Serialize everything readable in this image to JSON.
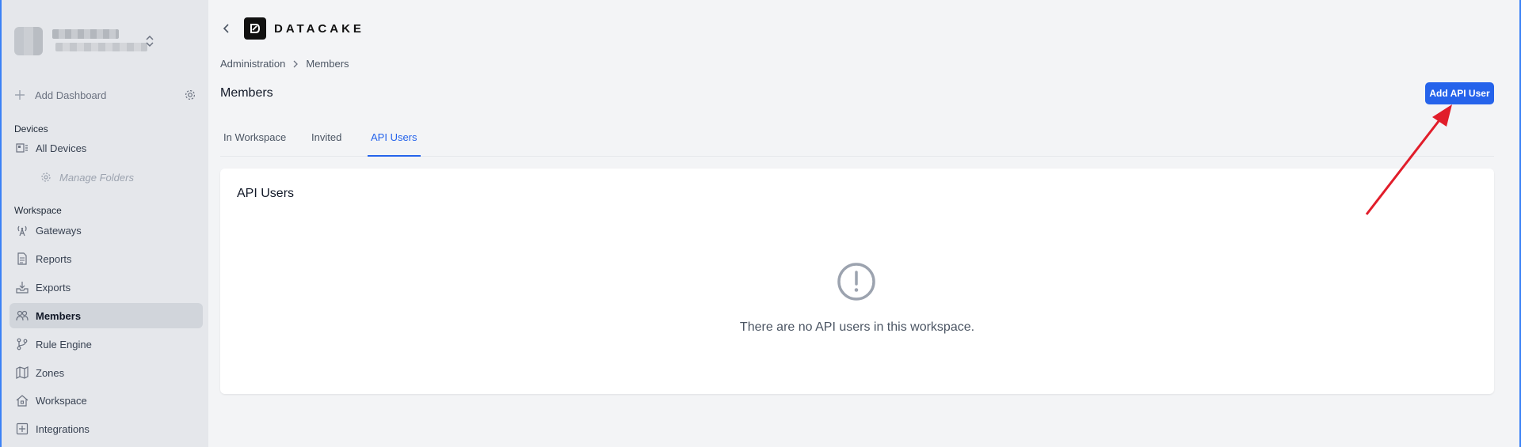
{
  "sidebar": {
    "add_dashboard": "Add Dashboard",
    "devices_label": "Devices",
    "all_devices": "All Devices",
    "manage_folders": "Manage Folders",
    "workspace_label": "Workspace",
    "items": [
      {
        "label": "Gateways",
        "icon": "antenna-icon"
      },
      {
        "label": "Reports",
        "icon": "document-icon"
      },
      {
        "label": "Exports",
        "icon": "download-tray-icon"
      },
      {
        "label": "Members",
        "icon": "users-icon",
        "active": true
      },
      {
        "label": "Rule Engine",
        "icon": "branch-icon"
      },
      {
        "label": "Zones",
        "icon": "map-icon"
      },
      {
        "label": "Workspace",
        "icon": "building-icon"
      },
      {
        "label": "Integrations",
        "icon": "plus-square-icon"
      }
    ]
  },
  "header": {
    "logo_text": "DATACAKE",
    "breadcrumb": [
      "Administration",
      "Members"
    ],
    "page_title": "Members",
    "add_button_label": "Add API User"
  },
  "tabs": [
    {
      "label": "In Workspace",
      "active": false
    },
    {
      "label": "Invited",
      "active": false
    },
    {
      "label": "API Users",
      "active": true
    }
  ],
  "card": {
    "title": "API Users",
    "empty_message": "There are no API users in this workspace.",
    "empty_icon": "exclamation-circle-icon"
  },
  "colors": {
    "accent": "#2563eb",
    "sidebar_bg": "#e5e7eb",
    "page_bg": "#f3f4f6",
    "annotation_arrow": "#e11d2a"
  }
}
